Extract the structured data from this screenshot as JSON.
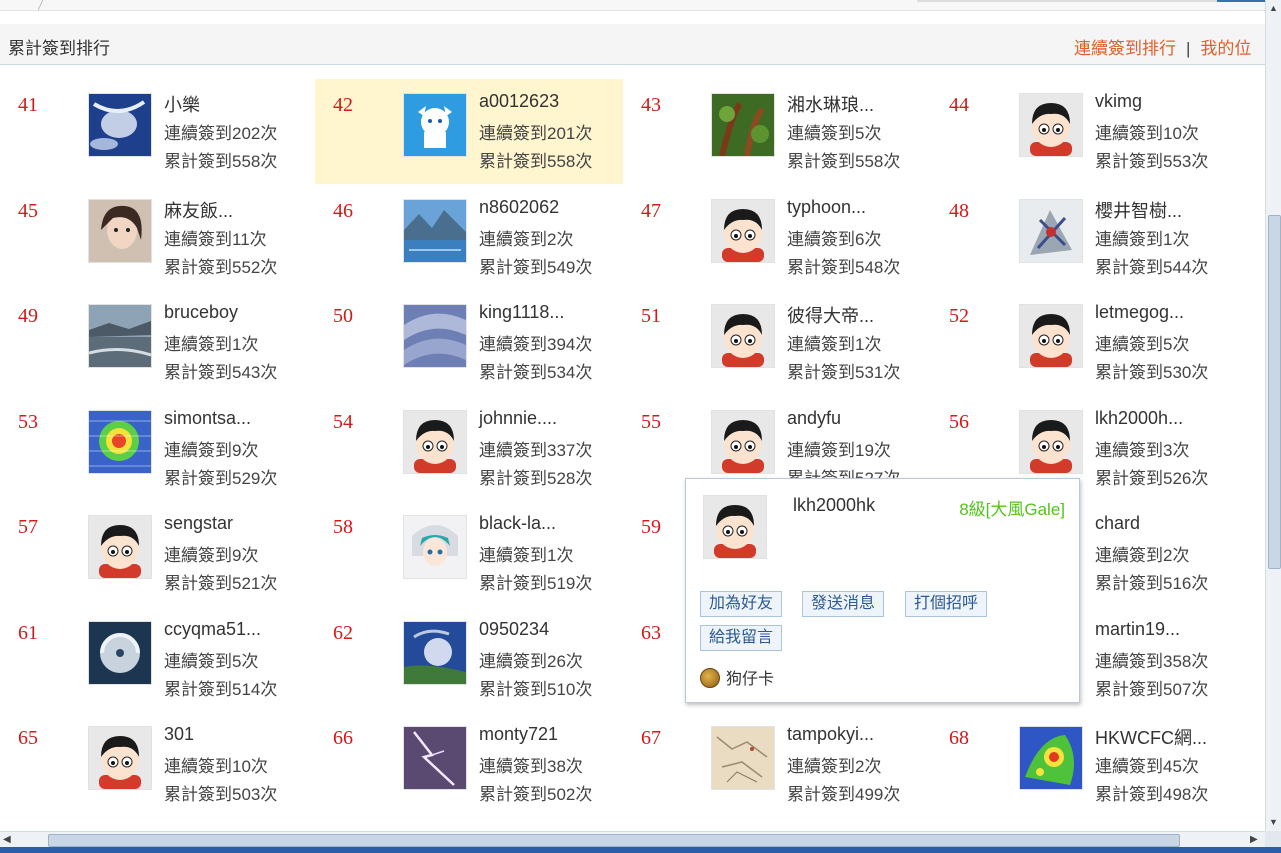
{
  "header": {
    "title": "累計簽到排行",
    "link_consecutive": "連續簽到排行",
    "link_mine": "我的位"
  },
  "rows": [
    {
      "rank": "41",
      "name": "小樂",
      "consec": "連續簽到202次",
      "total": "累計簽到558次",
      "avatar": "satellite-avatar"
    },
    {
      "rank": "42",
      "name": "a0012623",
      "consec": "連續簽到201次",
      "total": "累計簽到558次",
      "avatar": "anime-blue-avatar"
    },
    {
      "rank": "43",
      "name": "湘水琳琅...",
      "consec": "連續簽到5次",
      "total": "累計簽到558次",
      "avatar": "plant-avatar"
    },
    {
      "rank": "44",
      "name": "vkimg",
      "consec": "連續簽到10次",
      "total": "累計簽到553次",
      "avatar": "default-avatar"
    },
    {
      "rank": "45",
      "name": "麻友飯...",
      "consec": "連續簽到11次",
      "total": "累計簽到552次",
      "avatar": "girl-photo-avatar"
    },
    {
      "rank": "46",
      "name": "n8602062",
      "consec": "連續簽到2次",
      "total": "累計簽到549次",
      "avatar": "lake-avatar"
    },
    {
      "rank": "47",
      "name": "typhoon...",
      "consec": "連續簽到6次",
      "total": "累計簽到548次",
      "avatar": "default-avatar"
    },
    {
      "rank": "48",
      "name": "櫻井智樹...",
      "consec": "連續簽到1次",
      "total": "累計簽到544次",
      "avatar": "mecha-avatar"
    },
    {
      "rank": "49",
      "name": "bruceboy",
      "consec": "連續簽到1次",
      "total": "累計簽到543次",
      "avatar": "coast-avatar"
    },
    {
      "rank": "50",
      "name": "king1118...",
      "consec": "連續簽到394次",
      "total": "累計簽到534次",
      "avatar": "cloud-avatar"
    },
    {
      "rank": "51",
      "name": "彼得大帝...",
      "consec": "連續簽到1次",
      "total": "累計簽到531次",
      "avatar": "default-avatar"
    },
    {
      "rank": "52",
      "name": "letmegog...",
      "consec": "連續簽到5次",
      "total": "累計簽到530次",
      "avatar": "default-avatar"
    },
    {
      "rank": "53",
      "name": "simontsa...",
      "consec": "連續簽到9次",
      "total": "累計簽到529次",
      "avatar": "radar-avatar"
    },
    {
      "rank": "54",
      "name": "johnnie....",
      "consec": "連續簽到337次",
      "total": "累計簽到528次",
      "avatar": "default-avatar"
    },
    {
      "rank": "55",
      "name": "andyfu",
      "consec": "連續簽到19次",
      "total": "累計簽到527次",
      "avatar": "default-avatar"
    },
    {
      "rank": "56",
      "name": "lkh2000h...",
      "consec": "連續簽到3次",
      "total": "累計簽到526次",
      "avatar": "default-avatar"
    },
    {
      "rank": "57",
      "name": "sengstar",
      "consec": "連續簽到9次",
      "total": "累計簽到521次",
      "avatar": "default-avatar"
    },
    {
      "rank": "58",
      "name": "black-la...",
      "consec": "連續簽到1次",
      "total": "累計簽到519次",
      "avatar": "anime-girl-avatar"
    },
    {
      "rank": "59",
      "name": "",
      "consec": "",
      "total": "",
      "avatar": "none"
    },
    {
      "rank": "",
      "name": "chard",
      "consec": "連續簽到2次",
      "total": "累計簽到516次",
      "avatar": "none"
    },
    {
      "rank": "61",
      "name": "ccyqma51...",
      "consec": "連續簽到5次",
      "total": "累計簽到514次",
      "avatar": "typhoon-avatar"
    },
    {
      "rank": "62",
      "name": "0950234",
      "consec": "連續簽到26次",
      "total": "累計簽到510次",
      "avatar": "satellite2-avatar"
    },
    {
      "rank": "63",
      "name": "",
      "consec": "",
      "total": "",
      "avatar": "none"
    },
    {
      "rank": "",
      "name": "martin19...",
      "consec": "連續簽到358次",
      "total": "累計簽到507次",
      "avatar": "none"
    },
    {
      "rank": "65",
      "name": "301",
      "consec": "連續簽到10次",
      "total": "累計簽到503次",
      "avatar": "default-avatar"
    },
    {
      "rank": "66",
      "name": "monty721",
      "consec": "連續簽到38次",
      "total": "累計簽到502次",
      "avatar": "lightning-avatar"
    },
    {
      "rank": "67",
      "name": "tampokyi...",
      "consec": "連續簽到2次",
      "total": "累計簽到499次",
      "avatar": "map-avatar"
    },
    {
      "rank": "68",
      "name": "HKWCFC網...",
      "consec": "連續簽到45次",
      "total": "累計簽到498次",
      "avatar": "radar2-avatar"
    }
  ],
  "popup": {
    "username": "lkh2000hk",
    "level": "8級[大風Gale]",
    "btn_add_friend": "加為好友",
    "btn_send_message": "發送消息",
    "btn_greet": "打個招呼",
    "btn_leave_message": "給我留言",
    "card": "狗仔卡"
  }
}
